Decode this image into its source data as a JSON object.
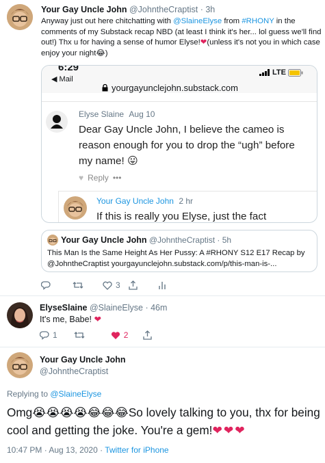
{
  "tweet1": {
    "name": "Your Gay Uncle John",
    "handle_time": "@JohntheCraptist · 3h",
    "text_a": "Anyway just out here chitchatting with ",
    "mention1": "@SlaineElyse",
    "text_b": " from ",
    "hashtag1": "#RHONY",
    "text_c": " in the comments of my Substack recap NBD (at least I think it's her...  lol guess we'll find out!) Thx u for having a sense of humor Elyse!",
    "text_d": "(unless it's not you in which case enjoy your night",
    "text_e": ")",
    "heart": "❤",
    "laugh": "😂"
  },
  "phone": {
    "clock": "6:29",
    "back_label": "Mail",
    "signal_label": "LTE",
    "url": "yourgayunclejohn.substack.com",
    "comment1": {
      "author": "Elyse Slaine",
      "date": "Aug 10",
      "text": "Dear Gay Uncle John, I believe the cameo is reason enough for you to drop the “ugh” before my name!",
      "emoji": "😛",
      "reply_label": "Reply",
      "more_label": "•••"
    },
    "comment2": {
      "author": "Your Gay Uncle John",
      "date": "2 hr",
      "text": "If this is really you Elyse, just the fact"
    }
  },
  "quoted": {
    "name": "Your Gay Uncle John",
    "handle_time": "@JohntheCraptist · 5h",
    "text_a": "This Man Is the Same Height As Her Pussy: A #RHONY S12 E17 Recap by @JohntheCraptist yourgayunclejohn.substack.com/p/this-man-is-..."
  },
  "tweet1_actions": {
    "likes": "3"
  },
  "tweet2": {
    "name": "ElyseSlaine",
    "handle_time": "@SlaineElyse · 46m",
    "text": "It's me, Babe!",
    "heart": "❤",
    "replies": "1",
    "likes": "2"
  },
  "tweet3": {
    "name": "Your Gay Uncle John",
    "handle": "@JohntheCraptist",
    "replying_prefix": "Replying to ",
    "replying_to": "@SlaineElyse",
    "lead": "Omg",
    "emojis": "😭😭😭😭😂😂😂",
    "text": "So lovely talking to you, thx for being cool and getting the joke. You're a gem!",
    "hearts": "❤❤❤",
    "timestamp": "10:47 PM · Aug 13, 2020 · ",
    "source": "Twitter for iPhone"
  },
  "colors": {
    "link": "#1b95e0",
    "muted": "#657786",
    "heart": "#e0245e",
    "border": "#ccd6dd"
  }
}
